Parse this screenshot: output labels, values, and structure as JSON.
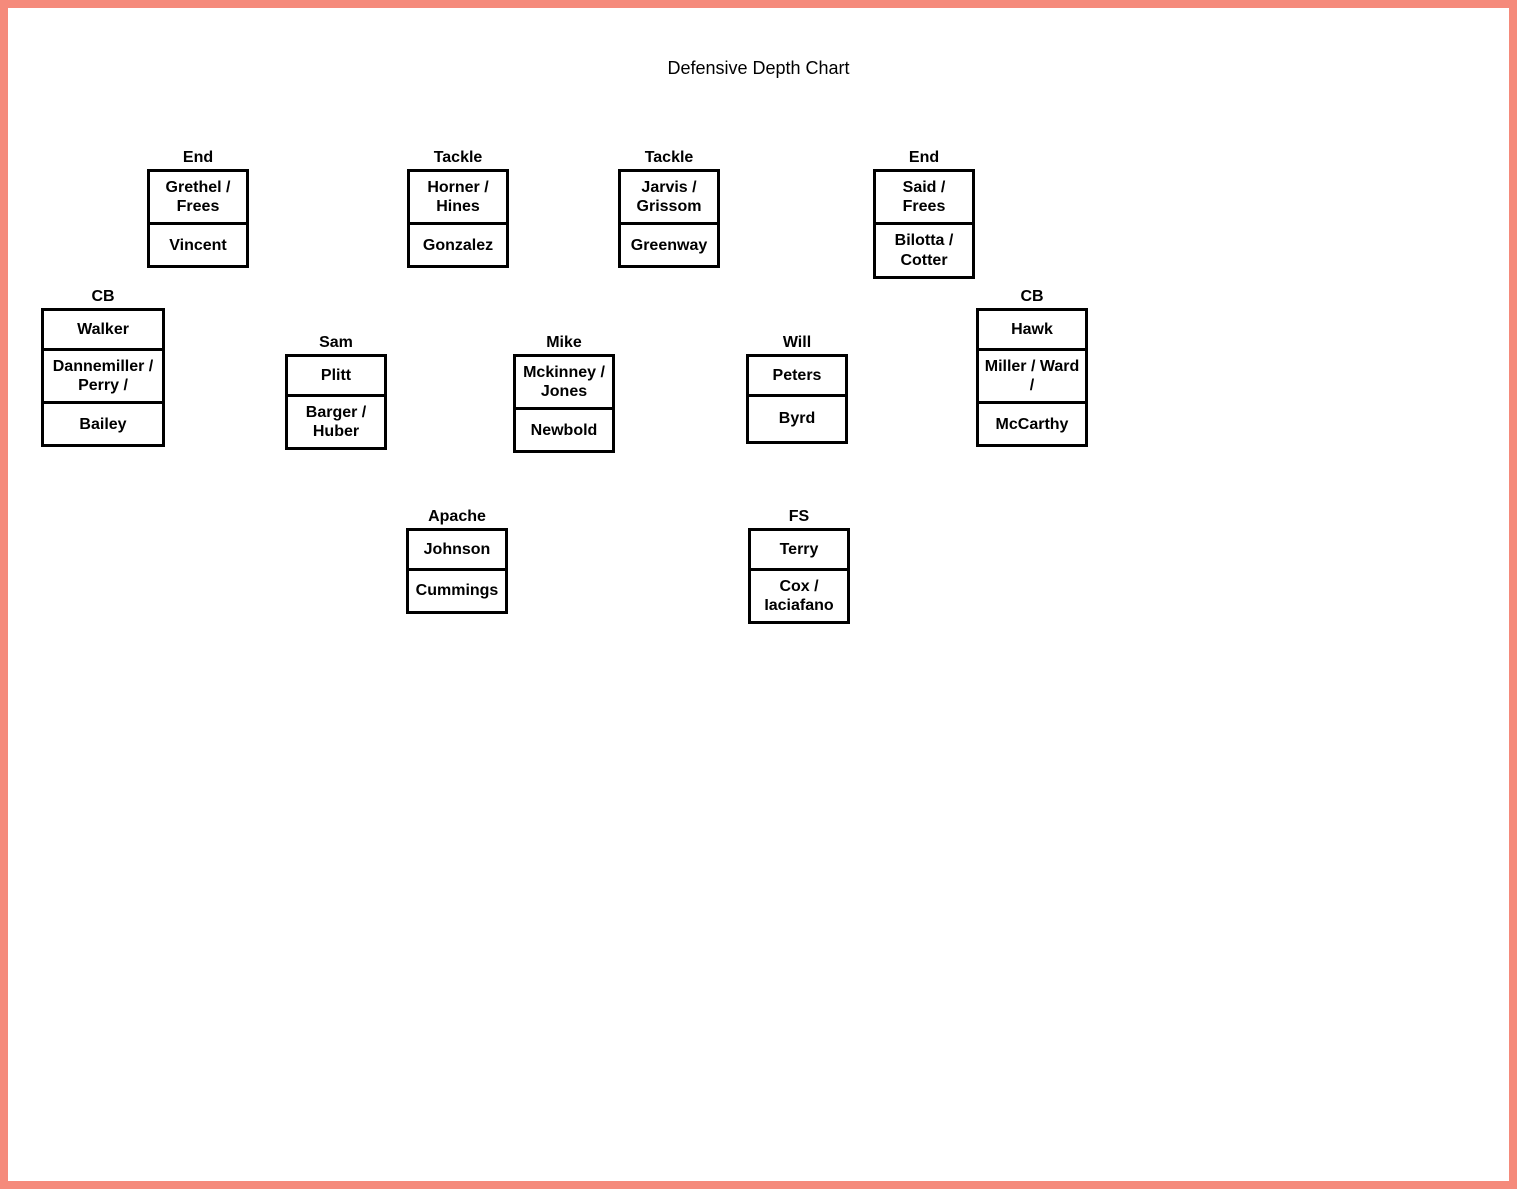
{
  "title": "Defensive Depth Chart",
  "positions": {
    "end1": {
      "label": "End",
      "cells": [
        "Grethel / Frees",
        "Vincent"
      ]
    },
    "tackle1": {
      "label": "Tackle",
      "cells": [
        "Horner / Hines",
        "Gonzalez"
      ]
    },
    "tackle2": {
      "label": "Tackle",
      "cells": [
        "Jarvis / Grissom",
        "Greenway"
      ]
    },
    "end2": {
      "label": "End",
      "cells": [
        "Said / Frees",
        "Bilotta / Cotter"
      ]
    },
    "cb1": {
      "label": "CB",
      "cells": [
        "Walker",
        "Dannemiller / Perry /",
        "Bailey"
      ]
    },
    "sam": {
      "label": "Sam",
      "cells": [
        "Plitt",
        "Barger / Huber"
      ]
    },
    "mike": {
      "label": "Mike",
      "cells": [
        "Mckinney / Jones",
        "Newbold"
      ]
    },
    "will": {
      "label": "Will",
      "cells": [
        "Peters",
        "Byrd"
      ]
    },
    "cb2": {
      "label": "CB",
      "cells": [
        "Hawk",
        "Miller / Ward /",
        "McCarthy"
      ]
    },
    "apache": {
      "label": "Apache",
      "cells": [
        "Johnson",
        "Cummings"
      ]
    },
    "fs": {
      "label": "FS",
      "cells": [
        "Terry",
        "Cox / Iaciafano"
      ]
    }
  }
}
